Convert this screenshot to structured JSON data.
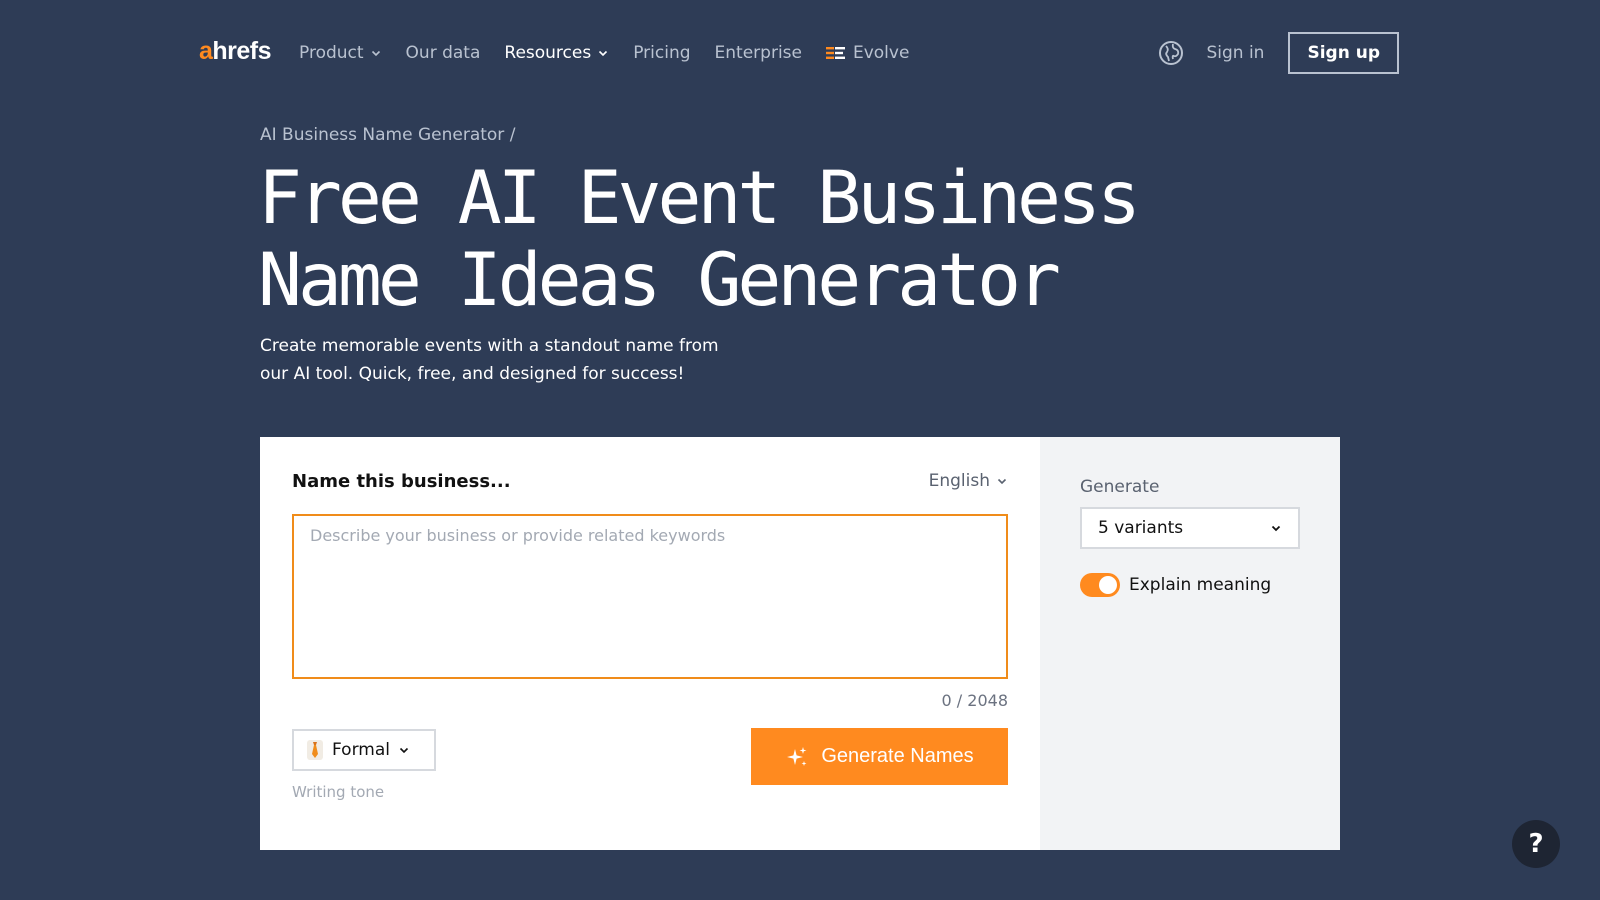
{
  "nav": {
    "logo_a": "a",
    "logo_rest": "hrefs",
    "items": [
      {
        "label": "Product",
        "dropdown": true
      },
      {
        "label": "Our data",
        "dropdown": false
      },
      {
        "label": "Resources",
        "dropdown": true
      },
      {
        "label": "Pricing",
        "dropdown": false
      },
      {
        "label": "Enterprise",
        "dropdown": false
      },
      {
        "label": "Evolve",
        "dropdown": false
      }
    ],
    "signin": "Sign in",
    "signup": "Sign up",
    "language_icon": "globe-icon"
  },
  "hero": {
    "breadcrumb": "AI Business Name Generator /",
    "title_line1": "Free AI Event Business",
    "title_line2": "Name Ideas Generator",
    "subtitle_line1": "Create memorable events with a standout name from",
    "subtitle_line2": "our AI tool. Quick, free, and designed for success!"
  },
  "form": {
    "label": "Name this business...",
    "language": "English",
    "placeholder": "Describe your business or provide related keywords",
    "value": "",
    "counter": "0 / 2048",
    "tone": "Formal",
    "tone_hint": "Writing tone",
    "generate_label": "Generate Names"
  },
  "settings": {
    "generate_label": "Generate",
    "variants": "5 variants",
    "explain_label": "Explain meaning",
    "explain_enabled": true
  },
  "help": {
    "label": "?"
  },
  "colors": {
    "background": "#2e3c56",
    "accent": "#ff8a1f",
    "card": "#ffffff",
    "side_panel": "#f2f3f5"
  }
}
